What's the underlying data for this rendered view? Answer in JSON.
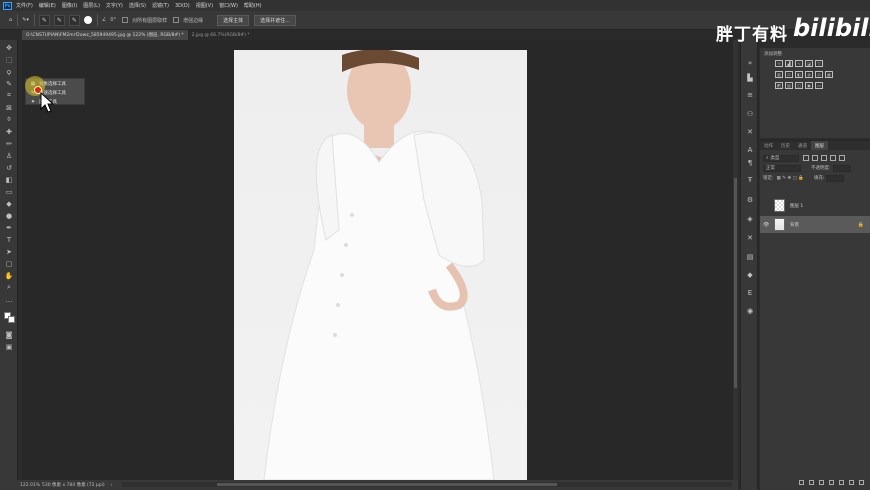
{
  "menubar": {
    "logo": "Ps",
    "items": [
      "文件(F)",
      "编辑(E)",
      "图像(I)",
      "图层(L)",
      "文字(Y)",
      "选择(S)",
      "滤镜(T)",
      "3D(D)",
      "视图(V)",
      "窗口(W)",
      "帮助(H)"
    ]
  },
  "options": {
    "angle_value": "0°",
    "sample_all_layers": "对所有图层取样",
    "enhance_edge": "增强边缘",
    "select_subject": "选择主体",
    "select_and_mask": "选择并遮住..."
  },
  "tabs": [
    {
      "label": "O:\\CNSTUPIAN\\FM2mrf2owz_585949495.jpg @ 122% (图层, RGB/8#) *",
      "active": true
    },
    {
      "label": "2.jpg @ 66.7%(RGB/8#) *",
      "active": false
    }
  ],
  "flyout": {
    "items": [
      "对象选择工具",
      "快速选择工具",
      "魔棒工具"
    ]
  },
  "status": {
    "zoom": "122.01%",
    "doc_info": "530 像素 x 784 像素 (72 ppi)"
  },
  "watermark": {
    "text": "胖丁有料",
    "logo": "bilibili"
  },
  "adjustments": {
    "title": "添加调整"
  },
  "layers": {
    "tabs": [
      {
        "label": "动作",
        "active": false
      },
      {
        "label": "历史",
        "active": false
      },
      {
        "label": "通道",
        "active": false
      },
      {
        "label": "图层",
        "active": true
      }
    ],
    "filter_label": "类型",
    "blend_mode": "正常",
    "opacity_label": "不透明度:",
    "lock_label": "锁定:",
    "fill_label": "填充:",
    "items": [
      {
        "name": "图层 1",
        "visible": false,
        "selected": false
      },
      {
        "name": "背景",
        "visible": true,
        "selected": true
      }
    ]
  }
}
